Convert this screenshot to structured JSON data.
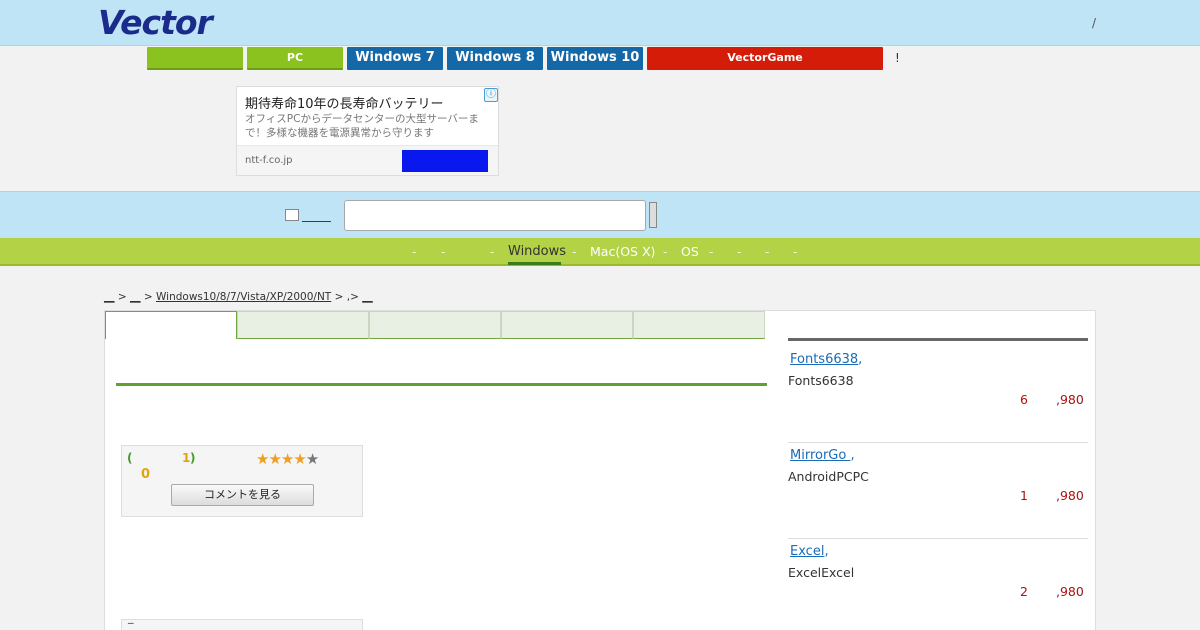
{
  "header": {
    "logo": "Vector",
    "right_text": "/"
  },
  "topnav": {
    "items": [
      {
        "label": "",
        "style": "green"
      },
      {
        "label": "PC",
        "style": "green"
      },
      {
        "label": "Windows 7",
        "style": "blue"
      },
      {
        "label": "Windows 8",
        "style": "blue"
      },
      {
        "label": "Windows 10",
        "style": "blue"
      },
      {
        "label": "VectorGame",
        "style": "red"
      }
    ],
    "trailing": "!"
  },
  "ad": {
    "title": "期待寿命10年の長寿命バッテリー",
    "description": "オフィスPCからデータセンターの大型サーバーまで！多様な機器を電源異常から守ります",
    "domain": "ntt-f.co.jp",
    "button_label": "",
    "info_icon": "ⓘ"
  },
  "search": {
    "placeholder": "",
    "value": ""
  },
  "catnav": {
    "items": [
      "-",
      "-",
      "-",
      "Windows",
      "-",
      "Mac(OS X)",
      "-",
      "OS",
      "-",
      "-",
      "-",
      "-"
    ],
    "active": "Windows"
  },
  "breadcrumb": {
    "parts": [
      "__",
      ">",
      "__",
      ">",
      "Windows10/8/7/Vista/XP/2000/NT",
      ">",
      ",>",
      "__"
    ]
  },
  "review": {
    "open_paren": "(",
    "count": "1",
    "close_paren": ")",
    "score": "0",
    "rating": 4,
    "max_rating": 5,
    "comment_button": "コメントを見る"
  },
  "lower_box": {
    "label": "‾"
  },
  "side_products": [
    {
      "title": "Fonts6638",
      "suffix": ",",
      "desc": "Fonts6638",
      "num": "6",
      "price": ",980"
    },
    {
      "title": "MirrorGo ",
      "suffix": ",",
      "desc": "AndroidPCPC",
      "num": "1",
      "price": ",980"
    },
    {
      "title": "Excel",
      "suffix": ",",
      "desc": "ExcelExcel",
      "num": "2",
      "price": ",980"
    }
  ]
}
